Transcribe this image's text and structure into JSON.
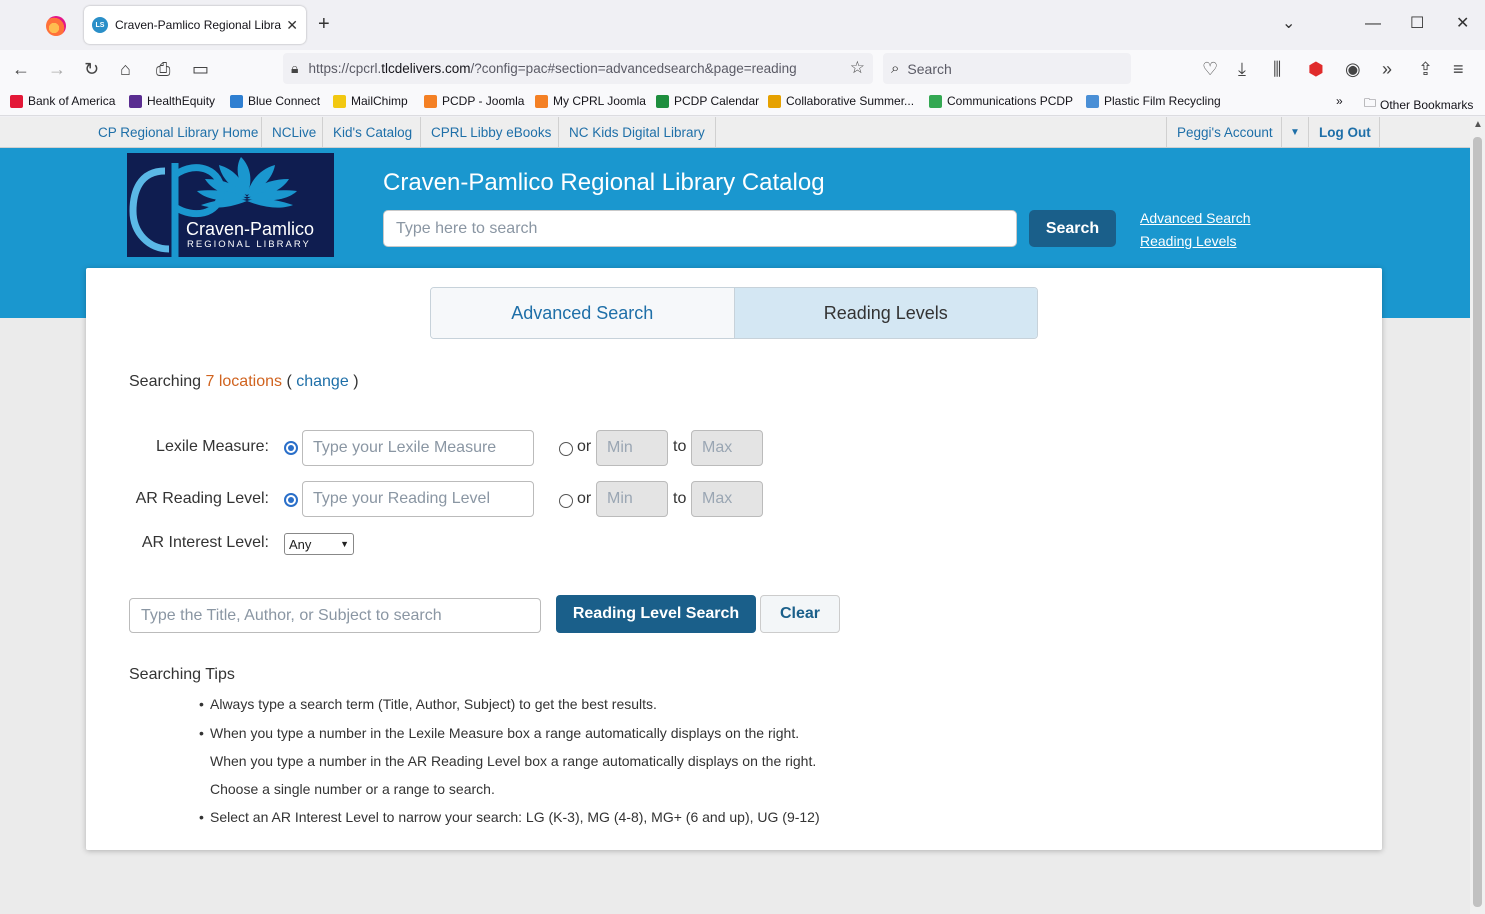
{
  "browser": {
    "tab_title": "Craven-Pamlico Regional Libra",
    "tab_favicon_text": "LS",
    "url_prefix": "https://cpcrl.",
    "url_domain": "tlcdelivers.com",
    "url_suffix": "/?config=pac#section=advancedsearch&page=reading",
    "search_placeholder": "Search",
    "bookmarks": [
      {
        "label": "Bank of America",
        "color": "#e31837"
      },
      {
        "label": "HealthEquity",
        "color": "#5a2d91"
      },
      {
        "label": "Blue Connect",
        "color": "#2f7fd1"
      },
      {
        "label": "MailChimp",
        "color": "#f2c811"
      },
      {
        "label": "PCDP - Joomla",
        "color": "#f48024"
      },
      {
        "label": "My CPRL Joomla",
        "color": "#f48024"
      },
      {
        "label": "PCDP Calendar",
        "color": "#1e8e3e"
      },
      {
        "label": "Collaborative Summer...",
        "color": "#e6a100"
      },
      {
        "label": "Communications PCDP",
        "color": "#34a853"
      },
      {
        "label": "Plastic Film Recycling",
        "color": "#4a8fd6"
      }
    ],
    "other_bookmarks": "Other Bookmarks"
  },
  "topnav": {
    "items": [
      "CP Regional Library Home",
      "NCLive",
      "Kid's Catalog",
      "CPRL Libby eBooks",
      "NC Kids Digital Library"
    ],
    "account": "Peggi's Account",
    "logout": "Log Out"
  },
  "header": {
    "logo_name": "Craven-Pamlico",
    "logo_sub": "REGIONAL LIBRARY",
    "title": "Craven-Pamlico Regional Library Catalog",
    "search_placeholder": "Type here to search",
    "search_button": "Search",
    "link_advanced": "Advanced Search",
    "link_reading": "Reading Levels"
  },
  "tabs": {
    "advanced": "Advanced Search",
    "reading": "Reading Levels"
  },
  "searching": {
    "prefix": "Searching",
    "locations": "7 locations",
    "open_paren": "(",
    "change": "change",
    "close_paren": ")"
  },
  "form": {
    "lexile_label": "Lexile Measure:",
    "lexile_placeholder": "Type your Lexile Measure",
    "ar_label": "AR Reading Level:",
    "ar_placeholder": "Type your Reading Level",
    "or_text": "or",
    "to_text": "to",
    "min_placeholder": "Min",
    "max_placeholder": "Max",
    "interest_label": "AR Interest Level:",
    "interest_selected": "Any",
    "keyword_placeholder": "Type the Title, Author, or Subject to search",
    "search_button": "Reading Level Search",
    "clear_button": "Clear"
  },
  "tips": {
    "heading": "Searching Tips",
    "lines": [
      "Always type a search term (Title, Author, Subject) to get the best results.",
      "When you type a number in the Lexile Measure box a range automatically displays on the right.",
      "When you type a number in the AR Reading Level box a range automatically displays on the right.",
      "Choose a single number or a range to search.",
      "Select an AR Interest Level to narrow your search: LG (K-3), MG (4-8), MG+ (6 and up), UG (9-12)"
    ]
  },
  "colors": {
    "banner": "#1a97cf",
    "button": "#1a5f8a",
    "link": "#1e6fa8",
    "locations": "#d0631f"
  }
}
